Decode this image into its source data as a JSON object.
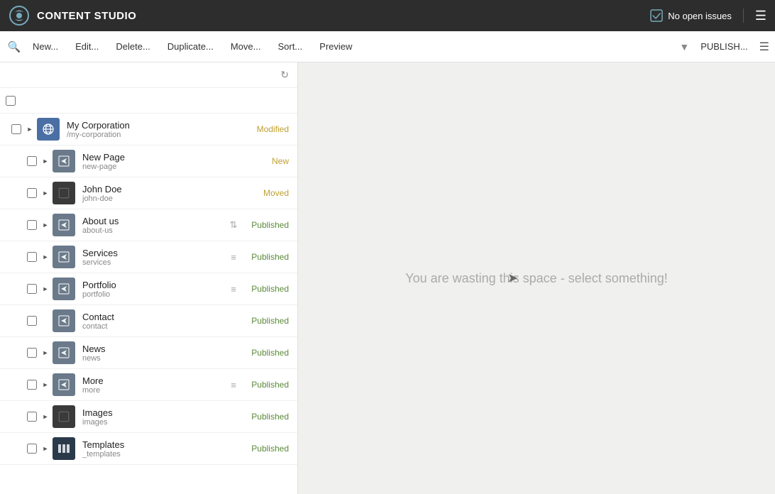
{
  "app": {
    "title": "CONTENT STUDIO"
  },
  "topbar": {
    "title": "CONTENT STUDIO",
    "issues_label": "No open issues",
    "issues_icon": "check-square-icon"
  },
  "toolbar": {
    "search_icon": "🔍",
    "new_label": "New...",
    "edit_label": "Edit...",
    "delete_label": "Delete...",
    "duplicate_label": "Duplicate...",
    "move_label": "Move...",
    "sort_label": "Sort...",
    "preview_label": "Preview",
    "publish_label": "PUBLISH...",
    "filter_icon": "▼",
    "list_icon": "≡"
  },
  "tree": {
    "refresh_icon": "↻",
    "items": [
      {
        "id": "my-corporation",
        "name": "My Corporation",
        "slug": "/my-corporation",
        "icon": "globe",
        "status": "Modified",
        "status_class": "status-modified",
        "indent": 1,
        "expandable": true,
        "expanded": true,
        "has_sort": false
      },
      {
        "id": "new-page",
        "name": "New Page",
        "slug": "new-page",
        "icon": "page",
        "status": "New",
        "status_class": "status-new",
        "indent": 2,
        "expandable": true,
        "has_sort": false
      },
      {
        "id": "john-doe",
        "name": "John Doe",
        "slug": "john-doe",
        "icon": "dark",
        "status": "Moved",
        "status_class": "status-moved",
        "indent": 2,
        "expandable": true,
        "has_sort": false
      },
      {
        "id": "about-us",
        "name": "About us",
        "slug": "about-us",
        "icon": "page",
        "status": "Published",
        "status_class": "status-published",
        "indent": 2,
        "expandable": true,
        "has_sort": true,
        "sort_icon": "⇅"
      },
      {
        "id": "services",
        "name": "Services",
        "slug": "services",
        "icon": "page",
        "status": "Published",
        "status_class": "status-published",
        "indent": 2,
        "expandable": true,
        "has_sort": true,
        "sort_icon": "≡"
      },
      {
        "id": "portfolio",
        "name": "Portfolio",
        "slug": "portfolio",
        "icon": "page",
        "status": "Published",
        "status_class": "status-published",
        "indent": 2,
        "expandable": true,
        "has_sort": true,
        "sort_icon": "≡"
      },
      {
        "id": "contact",
        "name": "Contact",
        "slug": "contact",
        "icon": "page",
        "status": "Published",
        "status_class": "status-published",
        "indent": 2,
        "expandable": false,
        "has_sort": false
      },
      {
        "id": "news",
        "name": "News",
        "slug": "news",
        "icon": "page",
        "status": "Published",
        "status_class": "status-published",
        "indent": 2,
        "expandable": true,
        "has_sort": false
      },
      {
        "id": "more",
        "name": "More",
        "slug": "more",
        "icon": "page",
        "status": "Published",
        "status_class": "status-published",
        "indent": 2,
        "expandable": true,
        "has_sort": true,
        "sort_icon": "≡"
      },
      {
        "id": "images",
        "name": "Images",
        "slug": "images",
        "icon": "dark",
        "status": "Published",
        "status_class": "status-published",
        "indent": 2,
        "expandable": true,
        "has_sort": false
      },
      {
        "id": "templates",
        "name": "Templates",
        "slug": "_templates",
        "icon": "cols",
        "status": "Published",
        "status_class": "status-published",
        "indent": 2,
        "expandable": true,
        "has_sort": false
      }
    ]
  },
  "right_panel": {
    "message": "You are wasting this space - select something!"
  }
}
